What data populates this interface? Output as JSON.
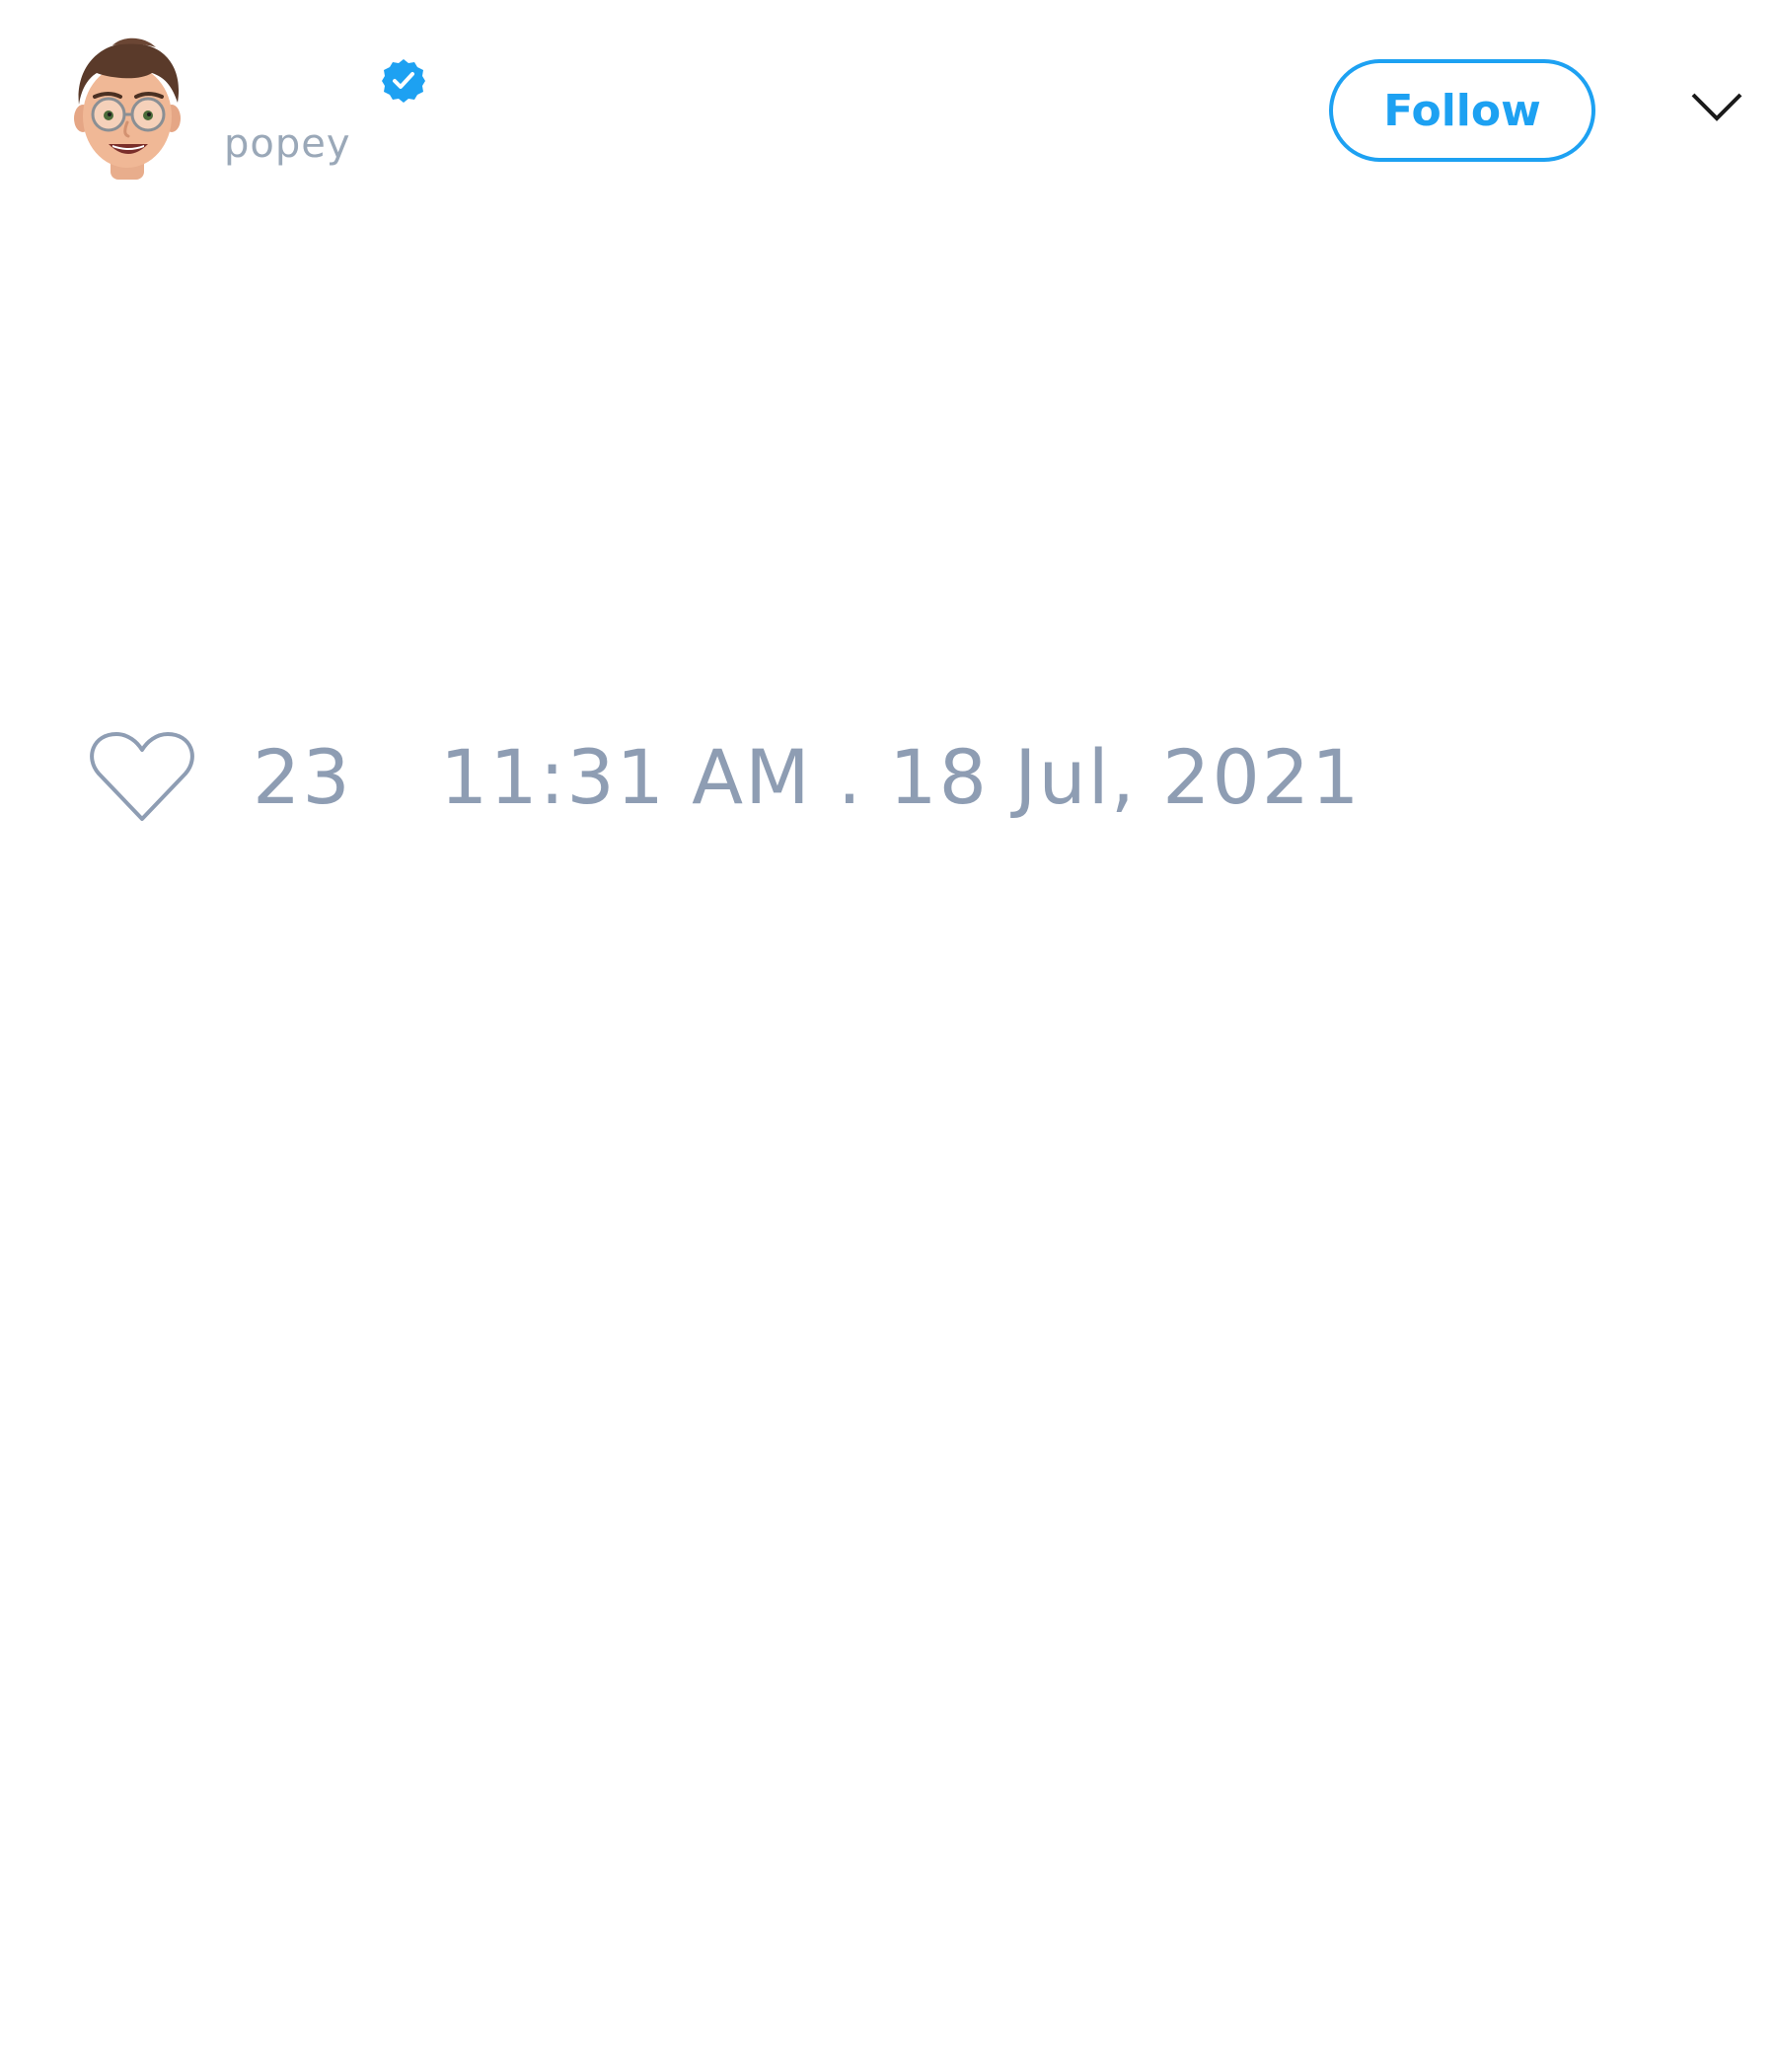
{
  "tweet": {
    "author": {
      "handle": "popey",
      "verified": true,
      "avatar_icon": "memoji-avatar"
    },
    "actions": {
      "follow_label": "Follow",
      "menu_icon": "chevron-down-icon"
    },
    "likes": {
      "icon": "heart-outline-icon",
      "count": "23"
    },
    "timestamp": "11:31 AM . 18 Jul, 2021"
  },
  "colors": {
    "accent": "#1da1f2",
    "muted_text": "#8e9db3",
    "background": "#ffffff"
  }
}
